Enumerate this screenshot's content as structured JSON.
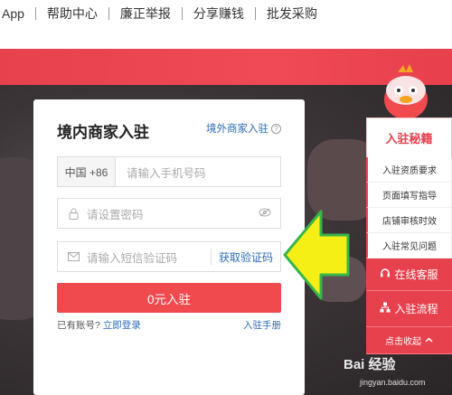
{
  "nav": {
    "items": [
      "App",
      "帮助中心",
      "廉正举报",
      "分享赚钱",
      "批发采购"
    ]
  },
  "colors": {
    "brand_red": "#e8414e",
    "link_blue": "#2b6bb5",
    "arrow_yellow": "#f5ef16",
    "arrow_green": "#39b54a"
  },
  "form": {
    "title": "境内商家入驻",
    "foreign_link": "境外商家入驻",
    "country_code": "中国 +86",
    "phone_placeholder": "请输入手机号码",
    "password_placeholder": "请设置密码",
    "sms_placeholder": "请输入短信验证码",
    "sms_button": "获取验证码",
    "submit_label": "0元入驻",
    "has_account_text": "已有账号?",
    "login_link": "立即登录",
    "manual_link": "入驻手册",
    "icons": [
      "lock-icon",
      "eye-off-icon",
      "mail-icon",
      "help-icon"
    ]
  },
  "side": {
    "header": "入驻秘籍",
    "items": [
      "入驻资质要求",
      "页面填写指导",
      "店铺审核时效",
      "入驻常见问题"
    ],
    "service": "在线客服",
    "process": "入驻流程",
    "collapse": "点击收起"
  },
  "watermark": {
    "brand": "Bai 经验",
    "url": "jingyan.baidu.com"
  }
}
